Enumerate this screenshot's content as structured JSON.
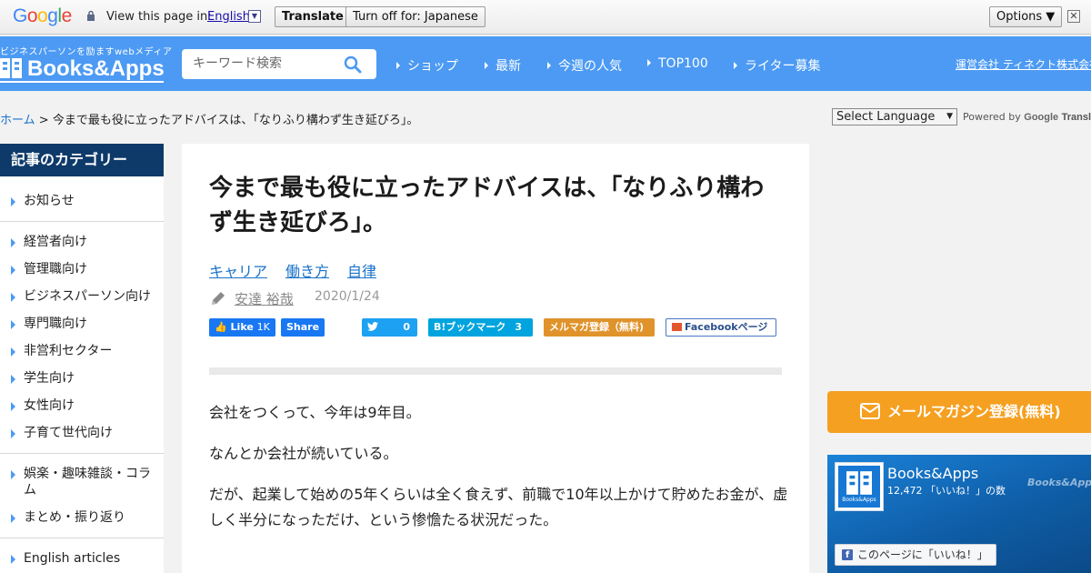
{
  "translate_bar": {
    "logo": "Google",
    "view_text": "View this page in:",
    "language": "English",
    "translate_label": "Translate",
    "turn_off_label": "Turn off for: Japanese",
    "options_label": "Options ▼",
    "close_label": "✕"
  },
  "header": {
    "tagline": "ビジネスパーソンを励ますwebメディア",
    "logo": "Books&Apps",
    "search_placeholder": "キーワード検索",
    "nav": [
      "ショップ",
      "最新",
      "今週の人気",
      "TOP100",
      "ライター募集"
    ],
    "company": "運営会社 ティネクト株式会社"
  },
  "breadcrumb": {
    "home": "ホーム",
    "separator": ">",
    "current": "今まで最も役に立ったアドバイスは、「なりふり構わず生き延びろ」。"
  },
  "language_select": {
    "value": "Select Language",
    "powered_by": "Powered by",
    "google": "Google",
    "translate": "Translate"
  },
  "sidebar": {
    "heading": "記事のカテゴリー",
    "items": [
      "お知らせ",
      "経営者向け",
      "管理職向け",
      "ビジネスパーソン向け",
      "専門職向け",
      "非営利セクター",
      "学生向け",
      "女性向け",
      "子育て世代向け",
      "娯楽・趣味雑談・コラム",
      "まとめ・振り返り",
      "English articles"
    ]
  },
  "article": {
    "title": "今まで最も役に立ったアドバイスは、「なりふり構わず生き延びろ」。",
    "tags": [
      "キャリア",
      "働き方",
      "自律"
    ],
    "author": "安達 裕哉",
    "date": "2020/1/24",
    "share": {
      "fb_like": "Like",
      "fb_like_count": "1K",
      "fb_share": "Share",
      "tweet_count": "0",
      "hatena_label": "B!ブックマーク",
      "hatena_count": "3",
      "mailmag": "メルマガ登録（無料)",
      "fb_page": "Facebookページ"
    },
    "paragraphs": [
      "会社をつくって、今年は9年目。",
      "なんとか会社が続いている。",
      "だが、起業して始めの5年くらいは全く食えず、前職で10年以上かけて貯めたお金が、虚しく半分になっただけ、という惨憺たる状況だった。"
    ]
  },
  "right": {
    "mailmag_button": "メールマガジン登録(無料)",
    "fb": {
      "name": "Books&Apps",
      "likes": "12,472 「いいね！」の数",
      "watermark": "Books&Apps",
      "like_page": "このページに「いいね！」",
      "logo_small": "Books&Apps"
    }
  },
  "colors": {
    "header_blue": "#4c9af3",
    "sidebar_navy": "#0e3a6a",
    "link_blue": "#1a73c9",
    "mailmag_orange": "#f5a020"
  }
}
